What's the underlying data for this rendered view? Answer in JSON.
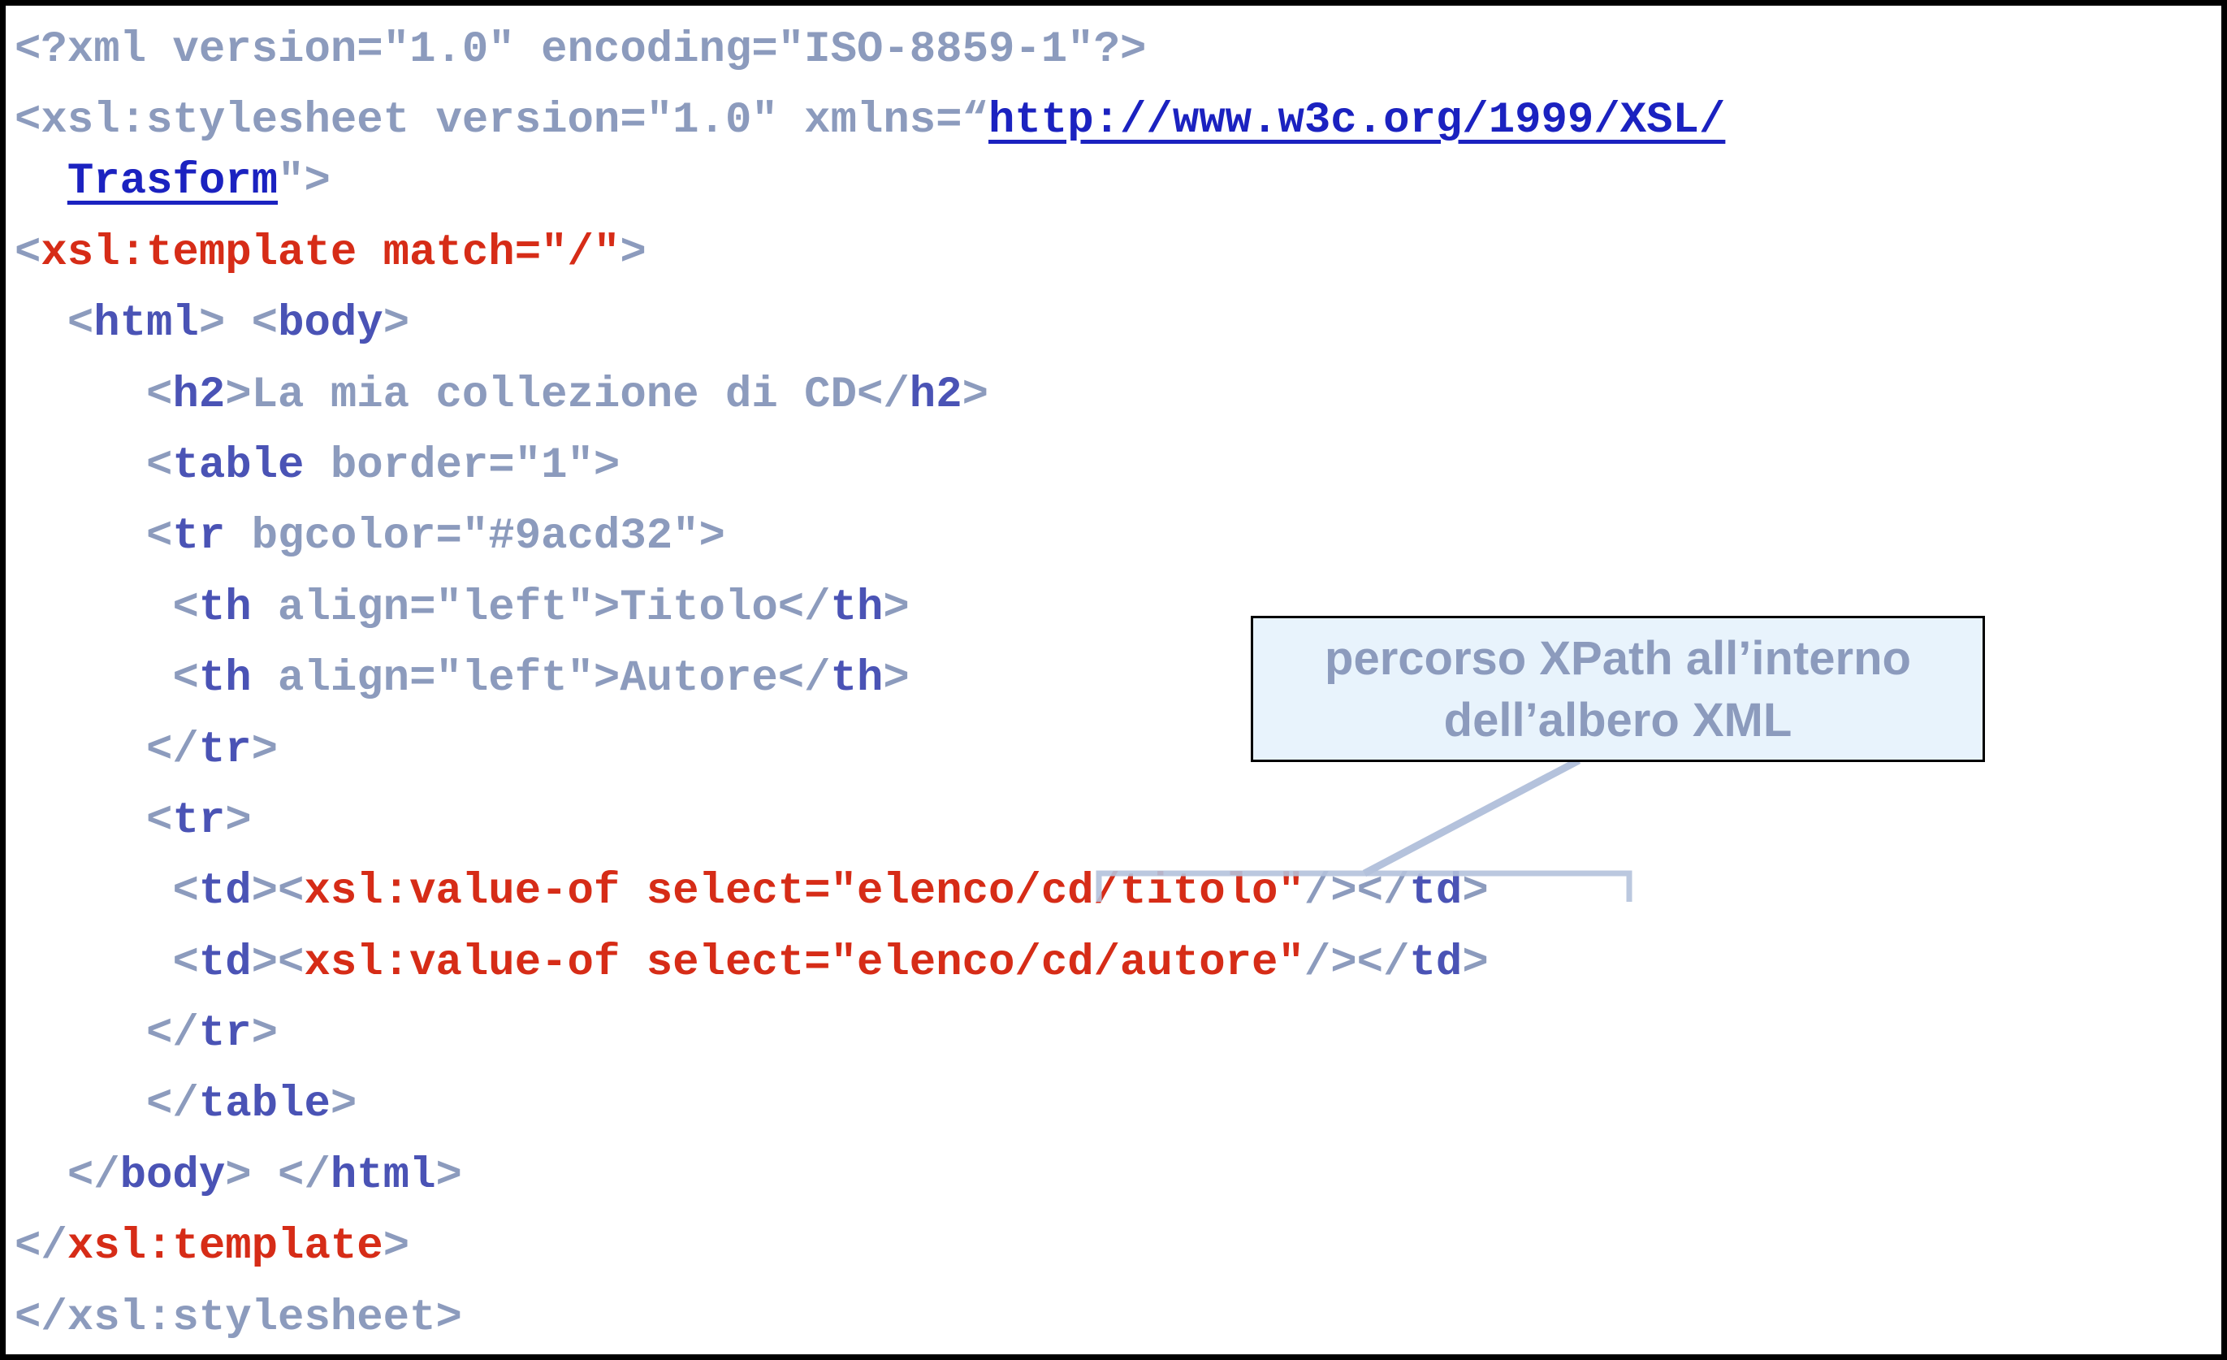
{
  "code": {
    "l1": {
      "a": "<?xml version=\"1.0\" encoding=\"ISO-8859-1\"?>"
    },
    "l2": {
      "a": "<xsl:stylesheet version=\"1.0\" xmlns=“",
      "link": "http://www.w3c.org/1999/XSL/"
    },
    "l3": {
      "indent": "  ",
      "link": "Trasform",
      "b": "\">"
    },
    "l4": {
      "p1": "<",
      "x1": "xsl:template",
      "x2": " match=\"/\"",
      "p2": ">"
    },
    "l5": {
      "indent": "  ",
      "p1": "<",
      "t1": "html",
      "p2": "> <",
      "t2": "body",
      "p3": ">"
    },
    "l6": {
      "indent": "     ",
      "p1": "<",
      "t1": "h2",
      "a1": ">La mia collezione di CD</",
      "t2": "h2",
      "p2": ">"
    },
    "l7": {
      "indent": "     ",
      "p1": "<",
      "t1": "table",
      "a1": " border=\"1\">"
    },
    "l8": {
      "indent": "     ",
      "p1": "<",
      "t1": "tr",
      "a1": " bgcolor=\"#9acd32\">"
    },
    "l9": {
      "indent": "      ",
      "p1": "<",
      "t1": "th",
      "a1": " align=\"left\">Titolo</",
      "t2": "th",
      "p2": ">"
    },
    "l10": {
      "indent": "      ",
      "p1": "<",
      "t1": "th",
      "a1": " align=\"left\">Autore</",
      "t2": "th",
      "p2": ">"
    },
    "l11": {
      "indent": "     ",
      "p1": "</",
      "t1": "tr",
      "p2": ">"
    },
    "l12": {
      "indent": "     ",
      "p1": "<",
      "t1": "tr",
      "p2": ">"
    },
    "l13": {
      "indent": "      ",
      "p1": "<",
      "t1": "td",
      "p2": "><",
      "x1": "xsl:value-of select=\"elenco/cd/titolo\"",
      "p3": "/></",
      "t2": "td",
      "p4": ">"
    },
    "l14": {
      "indent": "      ",
      "p1": "<",
      "t1": "td",
      "p2": "><",
      "x1": "xsl:value-of select=\"elenco/cd/autore\"",
      "p3": "/></",
      "t2": "td",
      "p4": ">"
    },
    "l15": {
      "indent": "     ",
      "p1": "</",
      "t1": "tr",
      "p2": ">"
    },
    "l16": {
      "indent": "     ",
      "p1": "</",
      "t1": "table",
      "p2": ">"
    },
    "l17": {
      "indent": "  ",
      "p1": "</",
      "t1": "body",
      "p2": "> </",
      "t2": "html",
      "p3": ">"
    },
    "l18": {
      "p1": "</",
      "x1": "xsl:template",
      "p2": ">"
    },
    "l19": {
      "a": "</xsl:stylesheet>"
    }
  },
  "callout": {
    "line1": "percorso XPath all’interno",
    "line2": "dell’albero XML"
  },
  "colors": {
    "tag": "#4a53b5",
    "xsl": "#d62c17",
    "attr": "#8c9bbd",
    "link": "#1b22c0",
    "callout_bg": "#e8f3fc",
    "pointer": "#b4c2dc"
  }
}
